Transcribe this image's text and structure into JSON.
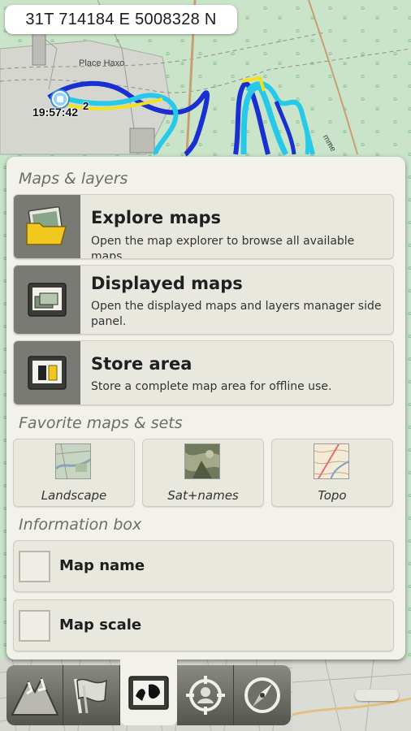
{
  "map": {
    "coordinates": "31T  714184 E  5008328 N",
    "place_label": "Place Haxo",
    "time_label": "19:57:42",
    "time_label_partial": "2",
    "street_fragment": "mme"
  },
  "panel": {
    "maps_section_title": "Maps & layers",
    "menu": [
      {
        "title": "Explore maps",
        "description": "Open the map explorer to browse all available maps.",
        "icon": "folder-icon"
      },
      {
        "title": "Displayed maps",
        "description": "Open the displayed maps and layers manager side panel.",
        "icon": "layers-icon"
      },
      {
        "title": "Store area",
        "description": "Store a complete map area for offline use.",
        "icon": "store-area-icon"
      }
    ],
    "favorites_section_title": "Favorite maps & sets",
    "favorites": [
      {
        "label": "Landscape"
      },
      {
        "label": "Sat+names"
      },
      {
        "label": "Topo"
      }
    ],
    "info_section_title": "Information box",
    "info_options": [
      {
        "label": "Map name",
        "checked": false
      },
      {
        "label": "Map scale",
        "checked": false
      }
    ]
  },
  "toolbar": {
    "buttons": [
      {
        "icon": "mountain-icon",
        "active": false
      },
      {
        "icon": "flag-icon",
        "active": false
      },
      {
        "icon": "maps-icon",
        "active": true
      },
      {
        "icon": "locate-icon",
        "active": false
      },
      {
        "icon": "compass-icon",
        "active": false
      }
    ]
  },
  "colors": {
    "panel_bg": "#f2f1ea",
    "card_bg": "#e9e8df",
    "icon_column": "#7a7a74",
    "track_blue": "#1a2fd0",
    "track_cyan": "#27c9e8",
    "track_yellow": "#f2e21d"
  }
}
